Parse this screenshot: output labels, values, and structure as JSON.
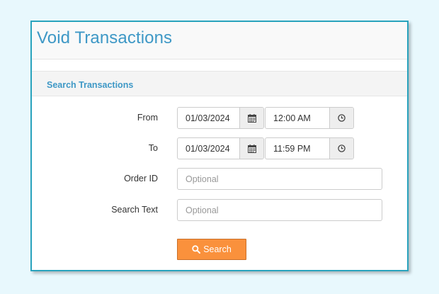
{
  "page": {
    "title": "Void Transactions"
  },
  "section": {
    "title": "Search Transactions"
  },
  "form": {
    "from": {
      "label": "From",
      "date": "01/03/2024",
      "time": "12:00 AM"
    },
    "to": {
      "label": "To",
      "date": "01/03/2024",
      "time": "11:59 PM"
    },
    "order_id": {
      "label": "Order ID",
      "value": "",
      "placeholder": "Optional"
    },
    "search_text": {
      "label": "Search Text",
      "value": "",
      "placeholder": "Optional"
    },
    "search_button": {
      "label": "Search"
    }
  },
  "icons": {
    "date_addon": "calendar-icon",
    "time_addon": "clock-icon",
    "search": "search-icon"
  },
  "colors": {
    "accent": "#3e98c6",
    "panel_border": "#2aa3bd",
    "button": "#fa913c",
    "background": "#e8f8fd"
  }
}
